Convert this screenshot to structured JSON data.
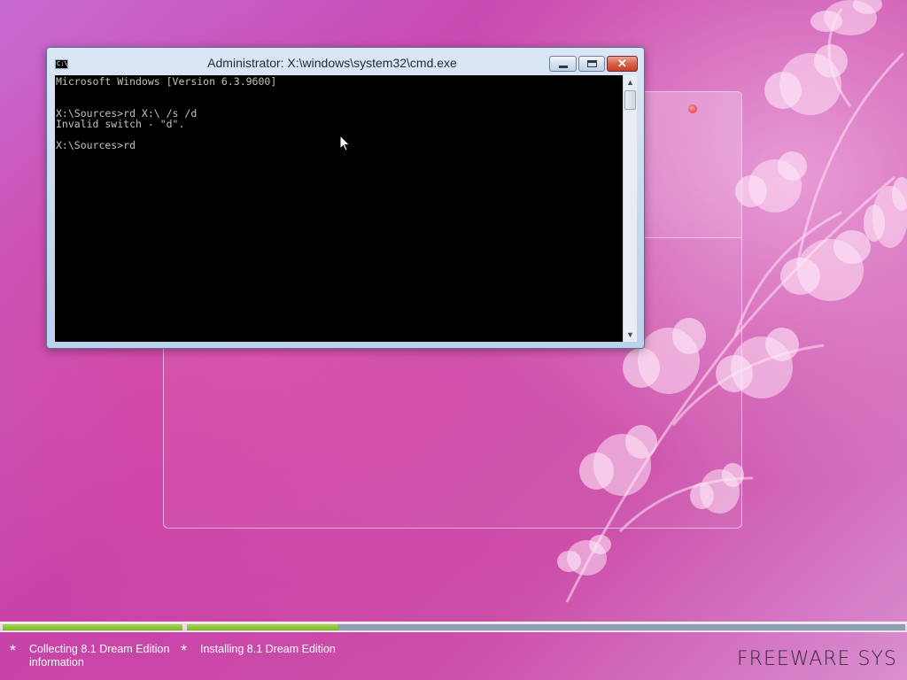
{
  "cmd_window": {
    "title": "Administrator: X:\\windows\\system32\\cmd.exe",
    "icon": "cmd-app-icon",
    "console_lines": [
      "Microsoft Windows [Version 6.3.9600]",
      "",
      "",
      "X:\\Sources>rd X:\\ /s /d",
      "Invalid switch - \"d\".",
      "",
      "X:\\Sources>rd"
    ]
  },
  "progress": {
    "steps": [
      {
        "label": "Collecting 8.1 Dream Edition information",
        "fill": 1.0
      },
      {
        "label": "Installing 8.1 Dream Edition",
        "fill": 0.21
      }
    ],
    "fill_color": "#8bc53f",
    "track_color": "#8d9fb4"
  },
  "branding": {
    "text": "FREEWARE SYS"
  },
  "colors": {
    "background_accent": "#c742a9",
    "close_button": "#d9624d"
  }
}
